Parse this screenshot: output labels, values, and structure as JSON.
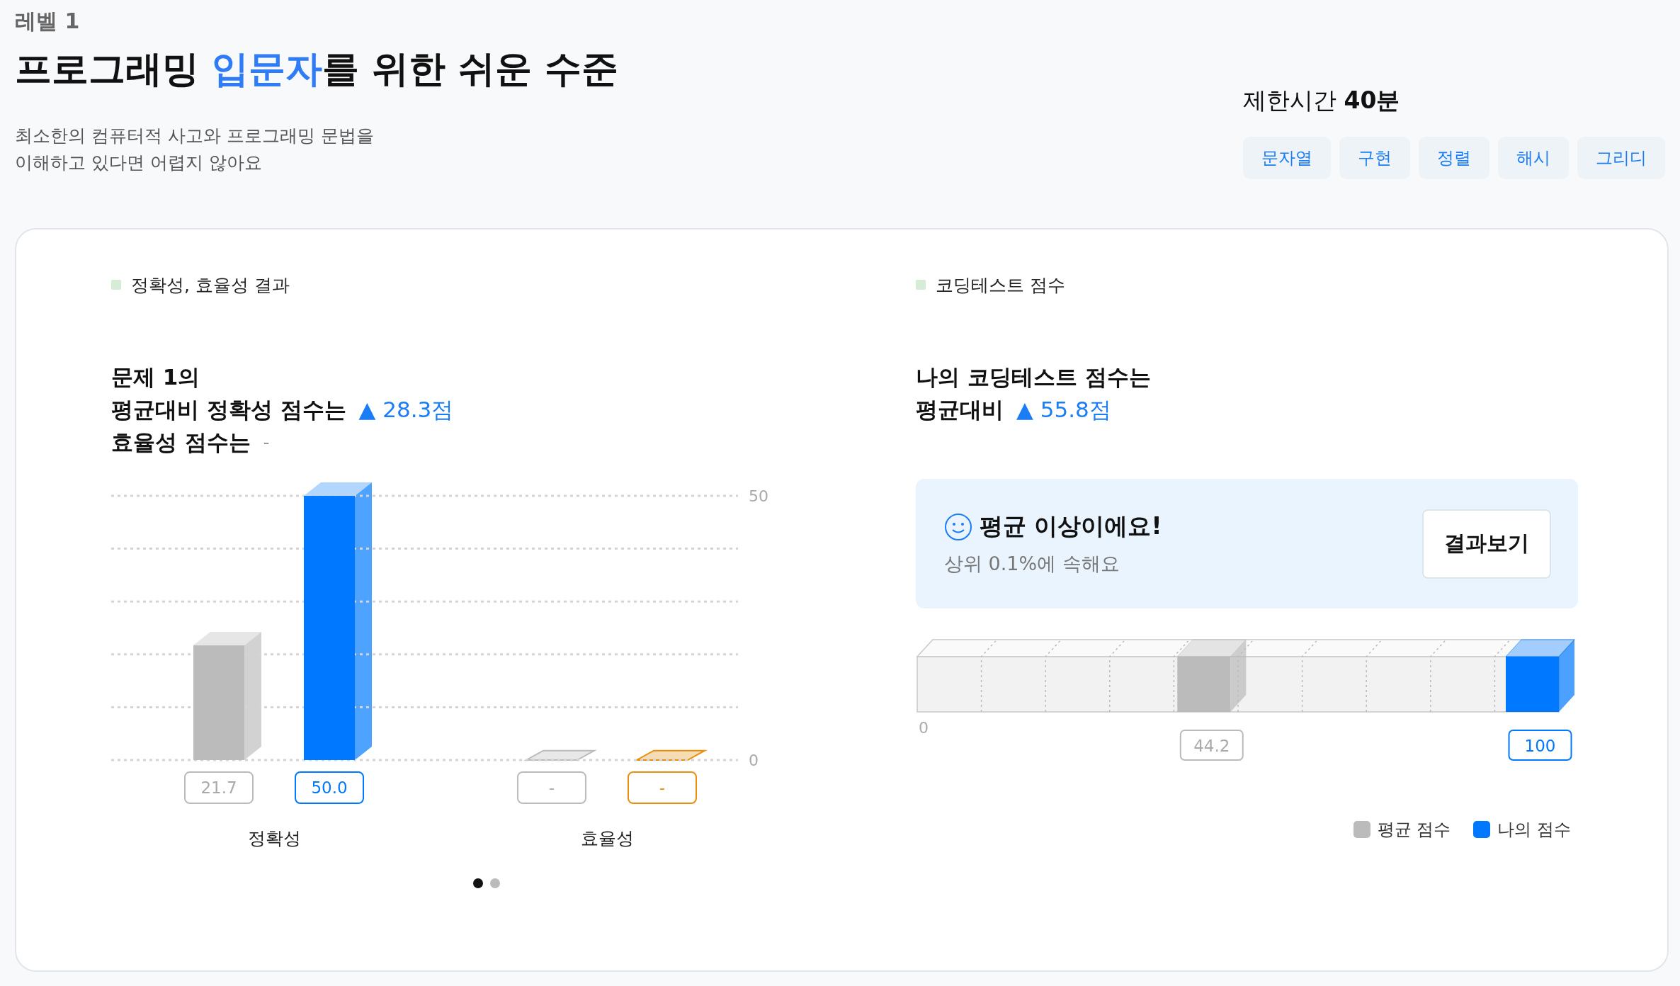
{
  "header": {
    "level": "레벨 1",
    "title_parts": [
      {
        "text": "프로그래밍 ",
        "highlighted": false
      },
      {
        "text": "입문자",
        "highlighted": true
      },
      {
        "text": "를 위한 쉬운 수준",
        "highlighted": false
      }
    ],
    "description_lines": [
      "최소한의 컴퓨터적 사고와 프로그래밍 문법을",
      "이해하고 있다면 어렵지 않아요"
    ],
    "time_limit": "제한시간 **40분**",
    "tags": [
      "문자열",
      "구현",
      "정렬",
      "해시",
      "그리디"
    ]
  },
  "accuracy_panel": {
    "legend": "정확성, 효율성 결과",
    "summary": [
      {
        "text": "문제 1의"
      },
      {
        "text": "평균대비 정확성 점수는",
        "delta": "▲ 28.3점",
        "highlighted": true
      },
      {
        "text": "효율성 점수는",
        "delta": "-",
        "highlighted": false
      }
    ],
    "chart_data": {
      "type": "bar",
      "categories": [
        "정확성",
        "효율성"
      ],
      "series": [
        {
          "color": "#bbbbbb",
          "values": [
            21.7,
            null
          ]
        },
        {
          "color": "#0078ff",
          "values": [
            50.0,
            null
          ]
        }
      ],
      "ylim": [
        0,
        50
      ],
      "yticks": [
        0,
        50
      ],
      "value_labels": [
        [
          "21.7",
          "-"
        ],
        [
          "50.0",
          "-"
        ]
      ]
    },
    "pagination": [
      {
        "selected": true
      },
      {
        "selected": false
      }
    ]
  },
  "score_panel": {
    "legend": "코딩테스트 점수",
    "summary": [
      {
        "text": "나의 코딩테스트 점수는"
      },
      {
        "text": "평균대비",
        "delta": "▲ 55.8점",
        "highlighted": true
      }
    ],
    "banner": {
      "title": "평균 이상이에요!",
      "subtitle": "상위 0.1%에 속해요",
      "button": "결과보기"
    },
    "score_scale": {
      "start_label": "0",
      "markers": [
        {
          "label": "44.2",
          "level": 0.442
        },
        {
          "label": "100",
          "level": 1
        }
      ]
    },
    "legend_items": [
      {
        "label": "평균 점수",
        "color": "#bbbbbb"
      },
      {
        "label": "나의 점수",
        "color": "#0078ff"
      }
    ]
  }
}
